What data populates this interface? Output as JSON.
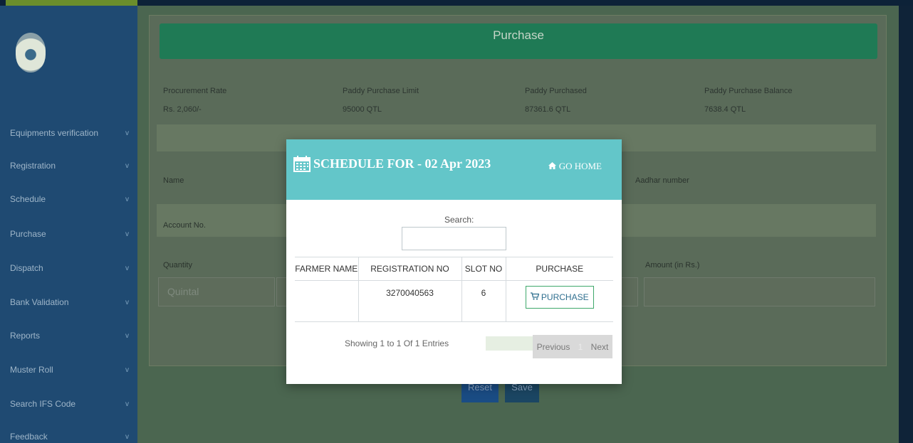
{
  "sidebar": {
    "items": [
      {
        "label": "Equipments verification"
      },
      {
        "label": "Registration"
      },
      {
        "label": "Schedule"
      },
      {
        "label": "Purchase"
      },
      {
        "label": "Dispatch"
      },
      {
        "label": "Bank Validation"
      },
      {
        "label": "Reports"
      },
      {
        "label": "Muster Roll"
      },
      {
        "label": "Search IFS Code"
      },
      {
        "label": "Feedback"
      }
    ],
    "chevron": "v"
  },
  "panel": {
    "title": "Purchase",
    "info": [
      {
        "label": "Procurement Rate",
        "value": "Rs. 2,060/-"
      },
      {
        "label": "Paddy Purchase Limit",
        "value": "95000 QTL"
      },
      {
        "label": "Paddy Purchased",
        "value": "87361.6 QTL"
      },
      {
        "label": "Paddy Purchase Balance",
        "value": "7638.4 QTL"
      }
    ],
    "fields": {
      "name_label": "Name",
      "aadhar_label": "Aadhar number",
      "account_label": "Account No.",
      "quantity_label": "Quantity",
      "quantity_placeholder": "Quintal",
      "amount_label": "Amount (in Rs.)"
    },
    "buttons": {
      "reset": "Reset",
      "save": "Save"
    }
  },
  "modal": {
    "title": "SCHEDULE FOR - 02 Apr 2023",
    "go_home": "GO HOME",
    "search_label": "Search:",
    "columns": [
      "FARMER NAME",
      "REGISTRATION NO",
      "SLOT NO",
      "PURCHASE"
    ],
    "rows": [
      {
        "farmer_name": "",
        "registration_no": "3270040563",
        "slot_no": "6",
        "purchase_label": "PURCHASE"
      }
    ],
    "showing": "Showing 1 to 1 Of 1 Entries",
    "pager": {
      "previous": "Previous",
      "current": "1",
      "next": "Next"
    }
  },
  "colors": {
    "modal_header": "#63c6c9",
    "panel_header": "#1f7a55",
    "sidebar": "#1f4a72"
  },
  "icons": {
    "calendar": "calendar-icon",
    "home": "home-icon",
    "cart": "cart-icon",
    "chevron": "chevron-down-icon"
  }
}
